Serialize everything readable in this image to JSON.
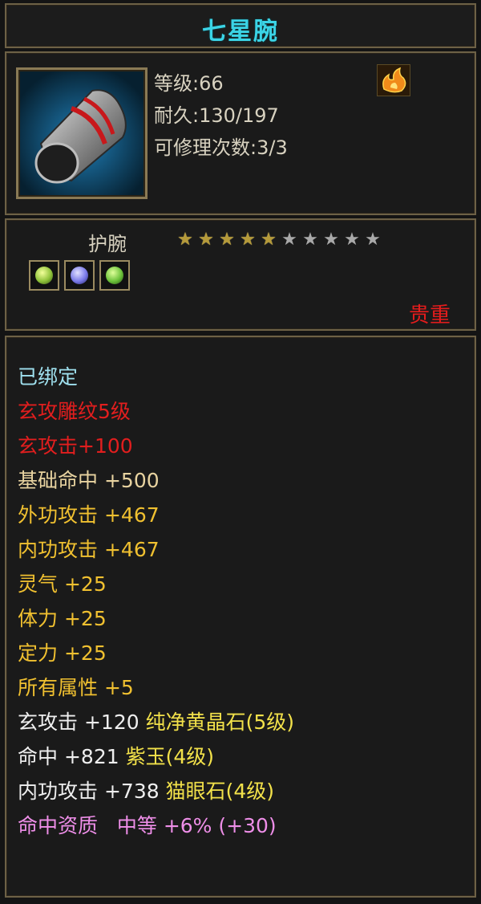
{
  "item": {
    "title": "七星腕",
    "level": "等级:66",
    "durability": "耐久:130/197",
    "repair": "可修理次数:3/3",
    "type": "护腕",
    "rarity": "贵重",
    "icon": "bracer-icon",
    "bind_icon": "fire-icon"
  },
  "stars": {
    "filled": 5,
    "total": 10
  },
  "gems": [
    {
      "name": "cat-eye-gem-icon",
      "color": "#8fc23a"
    },
    {
      "name": "purple-jade-gem-icon",
      "color": "#7a7ae8"
    },
    {
      "name": "cat-eye-gem-icon",
      "color": "#6cc23a"
    }
  ],
  "attributes": {
    "bound": "已绑定",
    "engrave": "玄攻雕纹5级",
    "engrave_bonus": "玄攻击+100",
    "base": [
      {
        "label": "基础命中",
        "value": "+500"
      },
      {
        "label": "外功攻击",
        "value": "+467"
      },
      {
        "label": "内功攻击",
        "value": "+467"
      }
    ],
    "extra": [
      {
        "label": "灵气",
        "value": "+25"
      },
      {
        "label": "体力",
        "value": "+25"
      },
      {
        "label": "定力",
        "value": "+25"
      },
      {
        "label": "所有属性",
        "value": "+5"
      }
    ],
    "gem_lines": [
      {
        "stat": "玄攻击",
        "value": "+120",
        "gem": "纯净黄晶石(5级)"
      },
      {
        "stat": "命中",
        "value": "+821",
        "gem": "紫玉(4级)"
      },
      {
        "stat": "内功攻击",
        "value": "+738",
        "gem": "猫眼石(4级)"
      }
    ],
    "aptitude": {
      "label": "命中资质",
      "grade": "中等",
      "bonus": "+6%",
      "extra": "(+30)"
    }
  },
  "colors": {
    "title": "#3bd4e6",
    "rarity": "#e41c1c",
    "engrave": "#e21e1e",
    "base": "#e8d3a0",
    "extra": "#f0c030",
    "gem_name": "#f2e14a",
    "aptitude": "#ee8ee8",
    "bound": "#9fe0ee"
  }
}
